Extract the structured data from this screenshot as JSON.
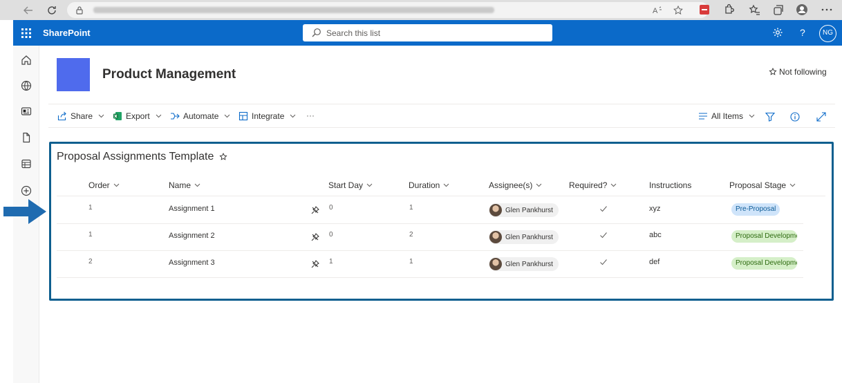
{
  "browser": {
    "icons": [
      "back-arrow-icon",
      "refresh-icon",
      "lock-icon",
      "read-aloud-icon",
      "favorite-add-icon",
      "extension-icon",
      "puzzle-icon",
      "favorites-icon",
      "collections-icon",
      "profile-icon",
      "more-icon"
    ]
  },
  "suite": {
    "brand": "SharePoint",
    "search_placeholder": "Search this list",
    "avatar_initials": "NG"
  },
  "site": {
    "title": "Product Management",
    "follow_label": "Not following"
  },
  "commands": {
    "share": "Share",
    "export": "Export",
    "automate": "Automate",
    "integrate": "Integrate",
    "more": "···",
    "view": "All Items"
  },
  "list": {
    "title": "Proposal Assignments Template",
    "columns": [
      "Order",
      "Name",
      "Start Day",
      "Duration",
      "Assignee(s)",
      "Required?",
      "Instructions",
      "Proposal Stage"
    ],
    "rows": [
      {
        "order": "1",
        "name": "Assignment 1",
        "start_day": "0",
        "duration": "1",
        "assignee": "Glen Pankhurst",
        "required": true,
        "instructions": "xyz",
        "stage": "Pre-Proposal"
      },
      {
        "order": "1",
        "name": "Assignment 2",
        "start_day": "0",
        "duration": "2",
        "assignee": "Glen Pankhurst",
        "required": true,
        "instructions": "abc",
        "stage": "Proposal Development"
      },
      {
        "order": "2",
        "name": "Assignment 3",
        "start_day": "1",
        "duration": "1",
        "assignee": "Glen Pankhurst",
        "required": true,
        "instructions": "def",
        "stage": "Proposal Development"
      }
    ]
  },
  "colors": {
    "suite_bar": "#0b6ac9",
    "site_logo": "#4f6bed",
    "highlight_border": "#0e5f8f",
    "arrow": "#1f6bb0"
  }
}
